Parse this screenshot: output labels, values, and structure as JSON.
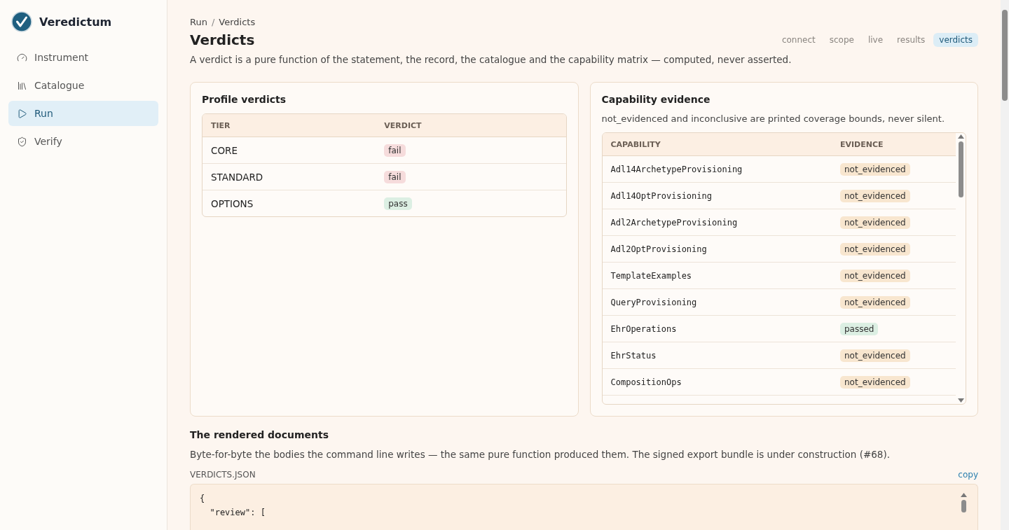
{
  "app": {
    "name": "Veredictum"
  },
  "sidebar": {
    "items": [
      {
        "label": "Instrument",
        "selected": false
      },
      {
        "label": "Catalogue",
        "selected": false
      },
      {
        "label": "Run",
        "selected": true
      },
      {
        "label": "Verify",
        "selected": false
      }
    ]
  },
  "breadcrumb": [
    "Run",
    "Verdicts"
  ],
  "breadcrumb_separator": "/",
  "page": {
    "title": "Verdicts",
    "description": "A verdict is a pure function of the statement, the record, the catalogue and the capability matrix — computed, never asserted."
  },
  "steps": [
    {
      "label": "connect",
      "selected": false
    },
    {
      "label": "scope",
      "selected": false
    },
    {
      "label": "live",
      "selected": false
    },
    {
      "label": "results",
      "selected": false
    },
    {
      "label": "verdicts",
      "selected": true
    }
  ],
  "profile_verdicts": {
    "title": "Profile verdicts",
    "columns": [
      "TIER",
      "VERDICT"
    ],
    "rows": [
      {
        "tier": "CORE",
        "verdict": "fail",
        "color": "#f6dcdc"
      },
      {
        "tier": "STANDARD",
        "verdict": "fail",
        "color": "#f6dcdc"
      },
      {
        "tier": "OPTIONS",
        "verdict": "pass",
        "color": "#dcefe3"
      }
    ]
  },
  "capability_evidence": {
    "title": "Capability evidence",
    "note": "not_evidenced and inconclusive are printed coverage bounds, never silent.",
    "columns": [
      "CAPABILITY",
      "EVIDENCE"
    ],
    "rows": [
      {
        "capability": "Adl14ArchetypeProvisioning",
        "evidence": "not_evidenced",
        "color": "#f8e6cf"
      },
      {
        "capability": "Adl14OptProvisioning",
        "evidence": "not_evidenced",
        "color": "#f8e6cf"
      },
      {
        "capability": "Adl2ArchetypeProvisioning",
        "evidence": "not_evidenced",
        "color": "#f8e6cf"
      },
      {
        "capability": "Adl2OptProvisioning",
        "evidence": "not_evidenced",
        "color": "#f8e6cf"
      },
      {
        "capability": "TemplateExamples",
        "evidence": "not_evidenced",
        "color": "#f8e6cf"
      },
      {
        "capability": "QueryProvisioning",
        "evidence": "not_evidenced",
        "color": "#f8e6cf"
      },
      {
        "capability": "EhrOperations",
        "evidence": "passed",
        "color": "#dcefe3"
      },
      {
        "capability": "EhrStatus",
        "evidence": "not_evidenced",
        "color": "#f8e6cf"
      },
      {
        "capability": "CompositionOps",
        "evidence": "not_evidenced",
        "color": "#f8e6cf"
      }
    ]
  },
  "documents": {
    "title": "The rendered documents",
    "description": "Byte-for-byte the bodies the command line writes — the same pure function produced them. The signed export bundle is under construction (#68).",
    "file": {
      "name": "VERDICTS.JSON",
      "action": "copy",
      "lines": [
        "{",
        "  \"review\": ["
      ]
    }
  }
}
